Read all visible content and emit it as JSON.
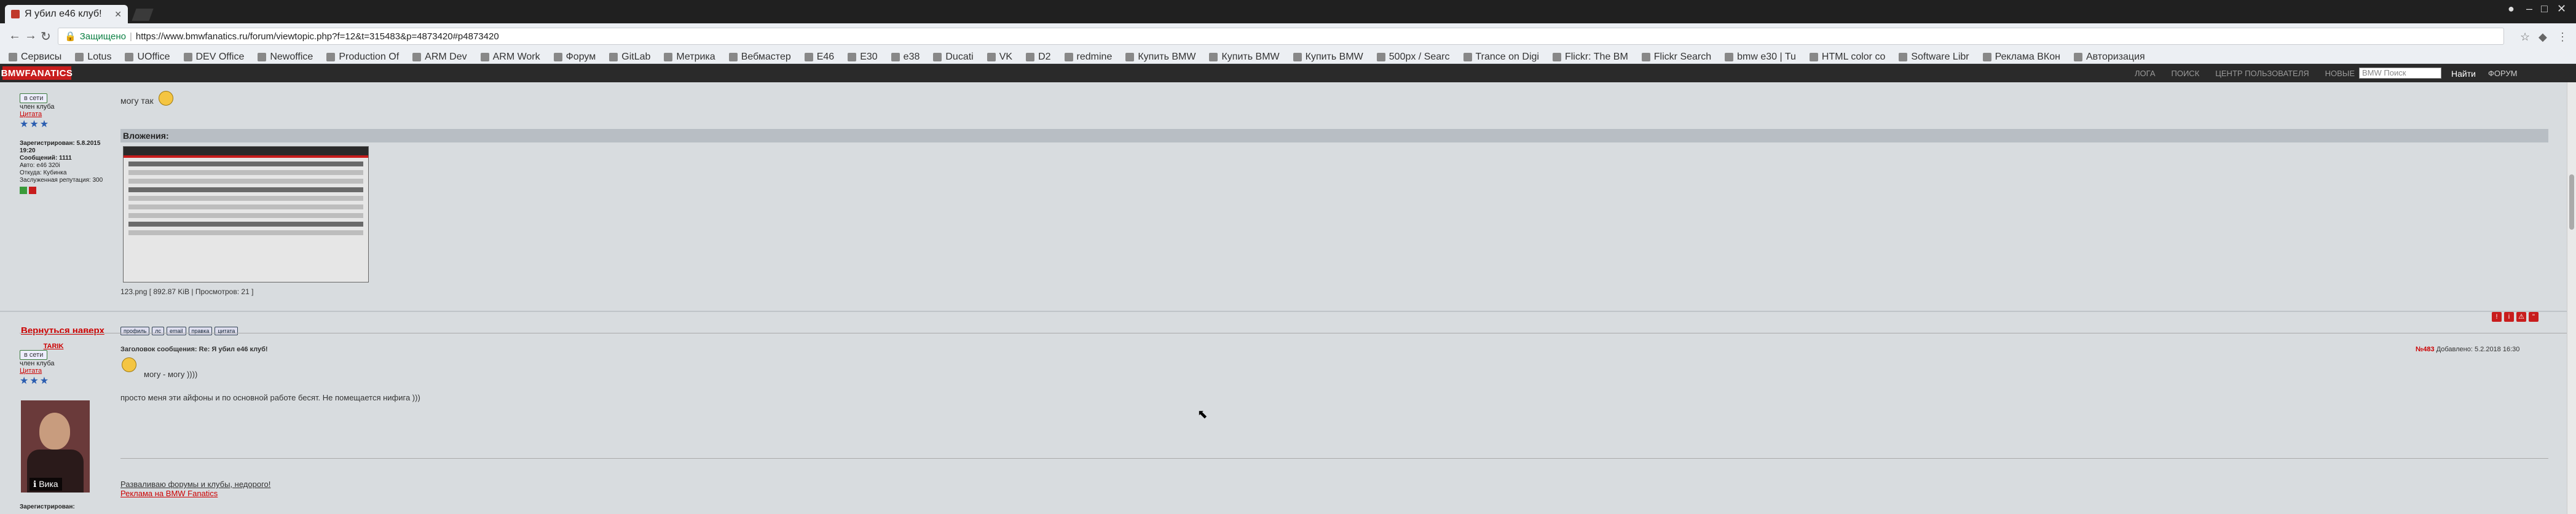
{
  "browser": {
    "tab_title": "Я убил е46 клуб!",
    "omnibox": {
      "secure_label": "Защищено",
      "url": "https://www.bmwfanatics.ru/forum/viewtopic.php?f=12&t=315483&p=4873420#p4873420"
    },
    "bookmarks": [
      "Сервисы",
      "Lotus",
      "UOffice",
      "DEV Office",
      "Newoffice",
      "Production Of",
      "ARM Dev",
      "ARM Work",
      "Форум",
      "GitLab",
      "Метрика",
      "Вебмастер",
      "E46",
      "E30",
      "e38",
      "Ducati",
      "VK",
      "D2",
      "redmine",
      "Купить BMW",
      "Купить BMW",
      "Купить BMW",
      "500px / Searc",
      "Trance on Digi",
      "Flickr: The BM",
      "Flickr Search",
      "bmw e30 | Tu",
      "HTML color co",
      "Software Libr",
      "Реклама ВКон",
      "Авторизация"
    ]
  },
  "site": {
    "logo": "BMWFANATICS",
    "nav_links": [
      "ЛОГА",
      "ПОИСК",
      "ЦЕНТР ПОЛЬЗОВАТЕЛЯ",
      "НОВЫЕ"
    ],
    "search_placeholder": "BMW Поиск",
    "find_label": "Найти",
    "forum_label": "ФОРУМ"
  },
  "post1": {
    "author_btn": "в сети",
    "rank": "член клуба",
    "quote_link": "Цитата",
    "registered": "Зарегистрирован: 5.8.2015 19:20",
    "posts": "Сообщений: 1111",
    "car": "Авто: e46 320i",
    "city": "Откуда: Кубинка",
    "reputation": "Заслуженная репутация: 300",
    "text": "могу так",
    "attach_header": "Вложения:",
    "attach_caption": "123.png [ 892.87 KiB | Просмотров: 21 ]"
  },
  "post2": {
    "back_to_top": "Вернуться наверх",
    "action_buttons": [
      "профиль",
      "лс",
      "email",
      "правка",
      "цитата"
    ],
    "author": "TARIK",
    "author_btn": "в сети",
    "rank": "член клуба",
    "quote_link": "Цитата",
    "title": "Заголовок сообщения: Re: Я убил е46 клуб!",
    "post_number": "№483",
    "date": "Добавлено: 5.2.2018 16:30",
    "line1": "могу - могу ))))",
    "line2": "просто меня эти айфоны и по основной работе бесят. Не помещается нифига )))",
    "sig1": "Разваливаю форумы и клубы, недорого!",
    "sig2": "Реклама на BMW Fanatics",
    "avatar_badge": "Вика",
    "registered_label": "Зарегистрирован:"
  }
}
